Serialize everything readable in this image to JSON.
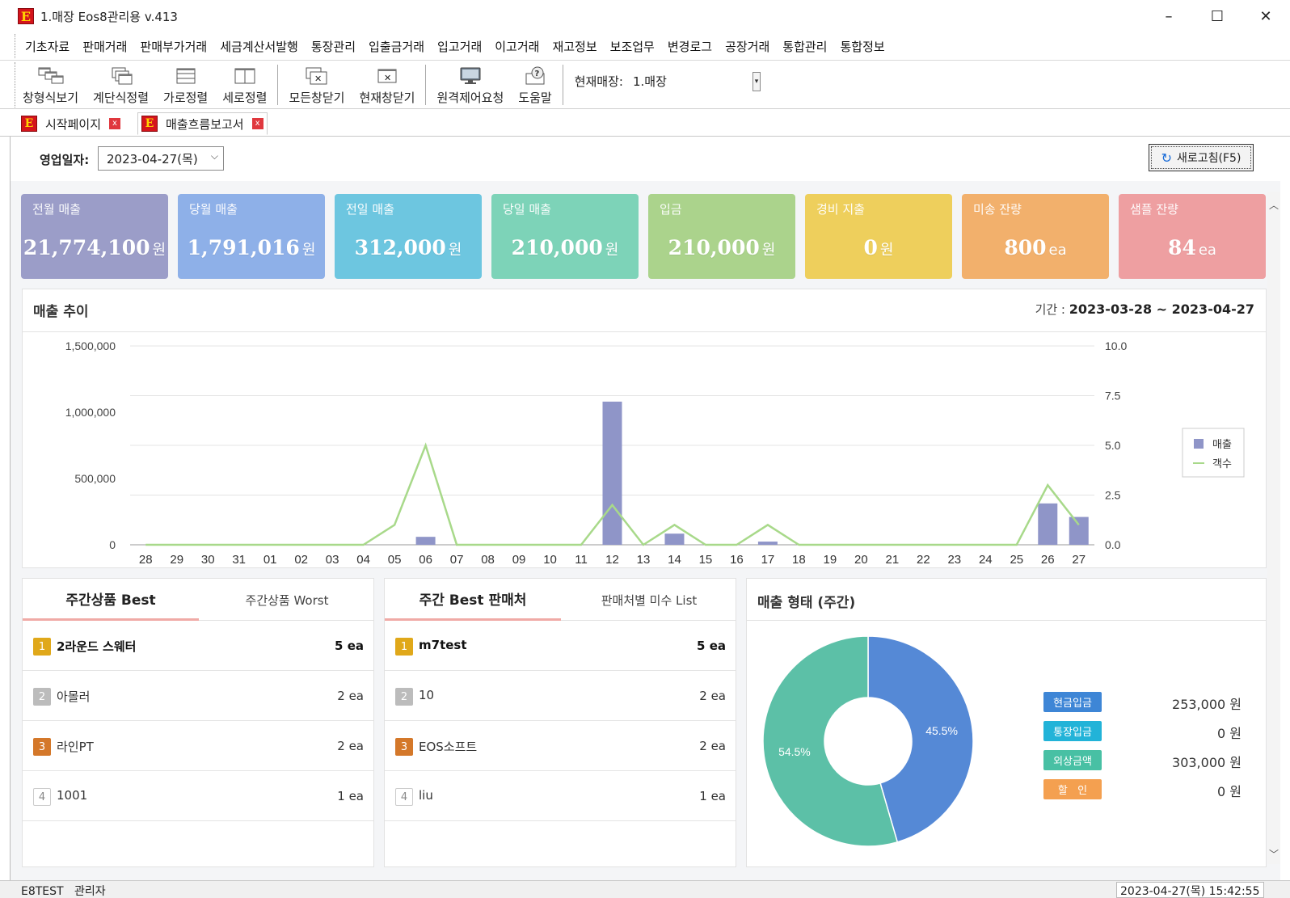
{
  "window": {
    "title": "1.매장 Eos8관리용 v.413",
    "logo_letter": "E",
    "minimize": "–",
    "maximize": "☐",
    "close": "✕"
  },
  "menu": [
    "기초자료",
    "판매거래",
    "판매부가거래",
    "세금계산서발행",
    "통장관리",
    "입출금거래",
    "입고거래",
    "이고거래",
    "재고정보",
    "보조업무",
    "변경로그",
    "공장거래",
    "통합관리",
    "통합정보"
  ],
  "toolbar": {
    "buttons": [
      "창형식보기",
      "계단식정렬",
      "가로정렬",
      "세로정렬",
      "모든창닫기",
      "현재창닫기",
      "원격제어요청",
      "도움말"
    ],
    "store_label": "현재매장:",
    "store_value": "1.매장"
  },
  "tabs": [
    {
      "label": "시작페이지",
      "close": "x"
    },
    {
      "label": "매출흐름보고서",
      "close": "x"
    }
  ],
  "filter": {
    "label": "영업일자:",
    "date": "2023-04-27(목)",
    "refresh": "새로고침(F5)"
  },
  "stats": [
    {
      "title": "전월 매출",
      "value": "21,774,100",
      "unit": "원",
      "color": "#9b9dc8"
    },
    {
      "title": "당월 매출",
      "value": "1,791,016",
      "unit": "원",
      "color": "#8eb0e8"
    },
    {
      "title": "전일 매출",
      "value": "312,000",
      "unit": "원",
      "color": "#6dc6e0"
    },
    {
      "title": "당일 매출",
      "value": "210,000",
      "unit": "원",
      "color": "#7dd3b8"
    },
    {
      "title": "입금",
      "value": "210,000",
      "unit": "원",
      "color": "#abd38c"
    },
    {
      "title": "경비 지출",
      "value": "0",
      "unit": "원",
      "color": "#eecf5c"
    },
    {
      "title": "미송 잔량",
      "value": "800",
      "unit": "ea",
      "color": "#f2b06c"
    },
    {
      "title": "샘플 잔량",
      "value": "84",
      "unit": "ea",
      "color": "#ee9fa1"
    }
  ],
  "trend": {
    "title": "매출 추이",
    "period_label": "기간 : ",
    "period": "2023-03-28 ~ 2023-04-27"
  },
  "chart_data": [
    {
      "type": "bar",
      "categories": [
        "28",
        "29",
        "30",
        "31",
        "01",
        "02",
        "03",
        "04",
        "05",
        "06",
        "07",
        "08",
        "09",
        "10",
        "11",
        "12",
        "13",
        "14",
        "15",
        "16",
        "17",
        "18",
        "19",
        "20",
        "21",
        "22",
        "23",
        "24",
        "25",
        "26",
        "27"
      ],
      "series": [
        {
          "name": "매출",
          "type": "bar",
          "axis": "left",
          "color": "#8f95c8",
          "values": [
            0,
            0,
            0,
            0,
            0,
            0,
            0,
            0,
            0,
            60000,
            0,
            0,
            0,
            0,
            0,
            1080000,
            0,
            84000,
            0,
            0,
            24000,
            0,
            0,
            0,
            0,
            0,
            0,
            0,
            0,
            312000,
            210000
          ]
        },
        {
          "name": "객수",
          "type": "line",
          "axis": "right",
          "color": "#a8d98a",
          "values": [
            0,
            0,
            0,
            0,
            0,
            0,
            0,
            0,
            1,
            5,
            0,
            0,
            0,
            0,
            0,
            2,
            0,
            1,
            0,
            0,
            1,
            0,
            0,
            0,
            0,
            0,
            0,
            0,
            0,
            3,
            1
          ]
        }
      ],
      "y_left": {
        "ticks": [
          "0",
          "500,000",
          "1,000,000",
          "1,500,000"
        ],
        "range": [
          0,
          1500000
        ]
      },
      "y_right": {
        "ticks": [
          "0.0",
          "2.5",
          "5.0",
          "7.5",
          "10.0"
        ],
        "range": [
          0,
          10
        ]
      },
      "legend": "right",
      "grid": true
    },
    {
      "type": "pie",
      "title": "매출 형태 (주간)",
      "slices": [
        {
          "label": "현금입금",
          "value": 45.5,
          "display": "45.5%",
          "color": "#5589d6"
        },
        {
          "label": "외상금액",
          "value": 54.5,
          "display": "54.5%",
          "color": "#5cc0a7"
        }
      ],
      "donut": true
    }
  ],
  "best_products": {
    "tab_active": "주간상품 Best",
    "tab_other": "주간상품 Worst",
    "items": [
      {
        "rank": "1",
        "name": "2라운드 스웨터",
        "qty": "5 ea"
      },
      {
        "rank": "2",
        "name": "아몰러",
        "qty": "2 ea"
      },
      {
        "rank": "3",
        "name": "라인PT",
        "qty": "2 ea"
      },
      {
        "rank": "4",
        "name": "1001",
        "qty": "1 ea"
      }
    ]
  },
  "best_vendors": {
    "tab_active": "주간 Best 판매처",
    "tab_other": "판매처별 미수 List",
    "items": [
      {
        "rank": "1",
        "name": "m7test",
        "qty": "5 ea"
      },
      {
        "rank": "2",
        "name": "10",
        "qty": "2 ea"
      },
      {
        "rank": "3",
        "name": "EOS소프트",
        "qty": "2 ea"
      },
      {
        "rank": "4",
        "name": "liu",
        "qty": "1 ea"
      }
    ]
  },
  "sales_type": {
    "title": "매출 형태 (주간)",
    "legend": [
      {
        "label": "현금입금",
        "value": "253,000 원",
        "color": "#3e86d6"
      },
      {
        "label": "통장입금",
        "value": "0 원",
        "color": "#22b3d8"
      },
      {
        "label": "외상금액",
        "value": "303,000 원",
        "color": "#48c0a4"
      },
      {
        "label": "할   인",
        "value": "0 원",
        "color": "#f4a050"
      }
    ]
  },
  "status": {
    "user": "E8TEST   관리자",
    "clock": "2023-04-27(목) 15:42:55"
  }
}
